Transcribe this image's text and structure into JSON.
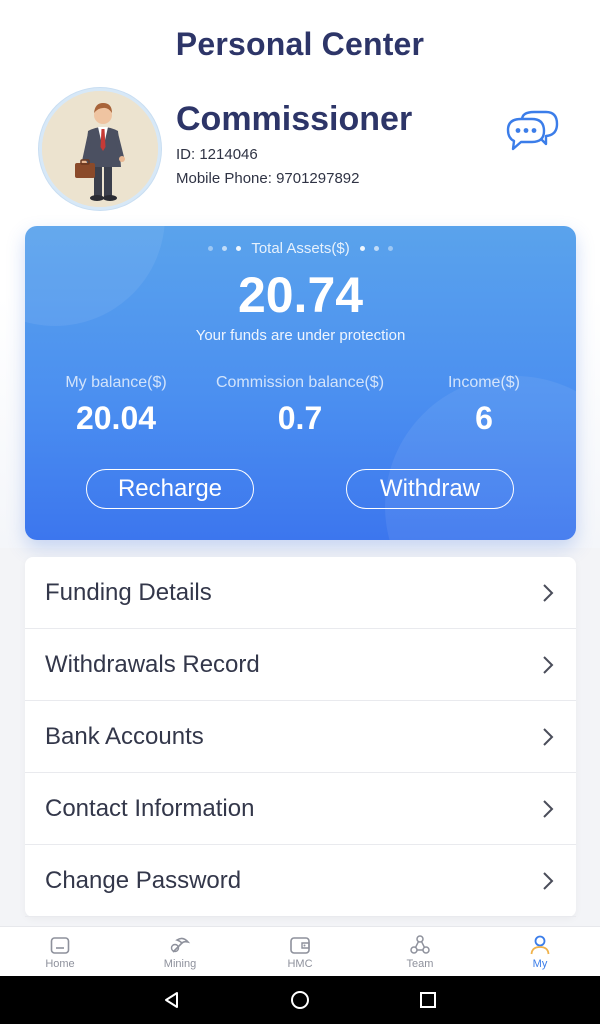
{
  "header": {
    "title": "Personal Center"
  },
  "profile": {
    "name": "Commissioner",
    "id_text": "ID: 1214046",
    "phone_text": "Mobile Phone: 9701297892"
  },
  "assets": {
    "total_label": "Total Assets($)",
    "total_value": "20.74",
    "protection_text": "Your funds are under protection",
    "balance_label": "My balance($)",
    "balance_value": "20.04",
    "commission_label": "Commission balance($)",
    "commission_value": "0.7",
    "income_label": "Income($)",
    "income_value": "6",
    "recharge_label": "Recharge",
    "withdraw_label": "Withdraw"
  },
  "menu": {
    "items": [
      {
        "label": "Funding Details"
      },
      {
        "label": "Withdrawals Record"
      },
      {
        "label": "Bank Accounts"
      },
      {
        "label": "Contact Information"
      },
      {
        "label": "Change Password"
      }
    ]
  },
  "tabbar": {
    "items": [
      {
        "label": "Home",
        "icon": "home-icon"
      },
      {
        "label": "Mining",
        "icon": "mining-icon"
      },
      {
        "label": "HMC",
        "icon": "wallet-icon"
      },
      {
        "label": "Team",
        "icon": "team-icon"
      },
      {
        "label": "My",
        "icon": "user-icon"
      }
    ],
    "active": "My"
  },
  "colors": {
    "title": "#2d3568",
    "accent": "#3b7de9",
    "card_top": "#5aa3ec",
    "card_bottom": "#3c76ee"
  }
}
